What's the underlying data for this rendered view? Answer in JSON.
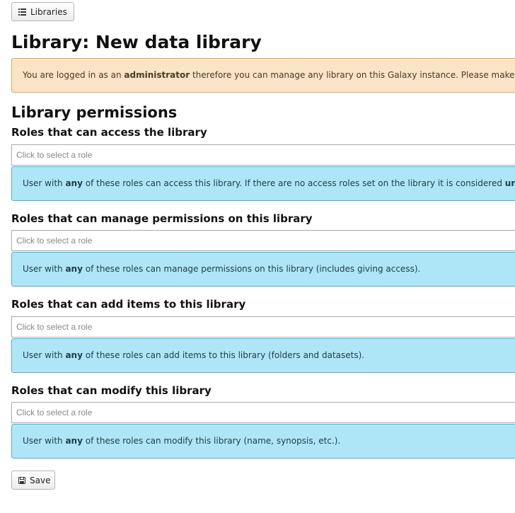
{
  "toolbar": {
    "libraries_label": "Libraries",
    "libraries_icon": "list-icon"
  },
  "page": {
    "title": "Library: New data library"
  },
  "warning": {
    "prefix": "You are logged in as an ",
    "bold": "administrator",
    "suffix": " therefore you can manage any library on this Galaxy instance. Please make sure"
  },
  "permissions": {
    "heading": "Library permissions",
    "access": {
      "label": "Roles that can access the library",
      "placeholder": "Click to select a role",
      "help_prefix": "User with ",
      "help_bold": "any",
      "help_suffix": " of these roles can access this library. If there are no access roles set on the library it is considered ",
      "help_bold2": "unrest"
    },
    "manage": {
      "label": "Roles that can manage permissions on this library",
      "placeholder": "Click to select a role",
      "help_prefix": "User with ",
      "help_bold": "any",
      "help_suffix": " of these roles can manage permissions on this library (includes giving access)."
    },
    "add": {
      "label": "Roles that can add items to this library",
      "placeholder": "Click to select a role",
      "help_prefix": "User with ",
      "help_bold": "any",
      "help_suffix": " of these roles can add items to this library (folders and datasets)."
    },
    "modify": {
      "label": "Roles that can modify this library",
      "placeholder": "Click to select a role",
      "help_prefix": "User with ",
      "help_bold": "any",
      "help_suffix": " of these roles can modify this library (name, synopsis, etc.)."
    }
  },
  "actions": {
    "save_label": "Save",
    "save_icon": "floppy-disk-icon"
  },
  "colors": {
    "warning_bg": "#fbe3c5",
    "warning_border": "#e3a768",
    "info_bg": "#aee6f8",
    "info_border": "#49b3d8"
  }
}
